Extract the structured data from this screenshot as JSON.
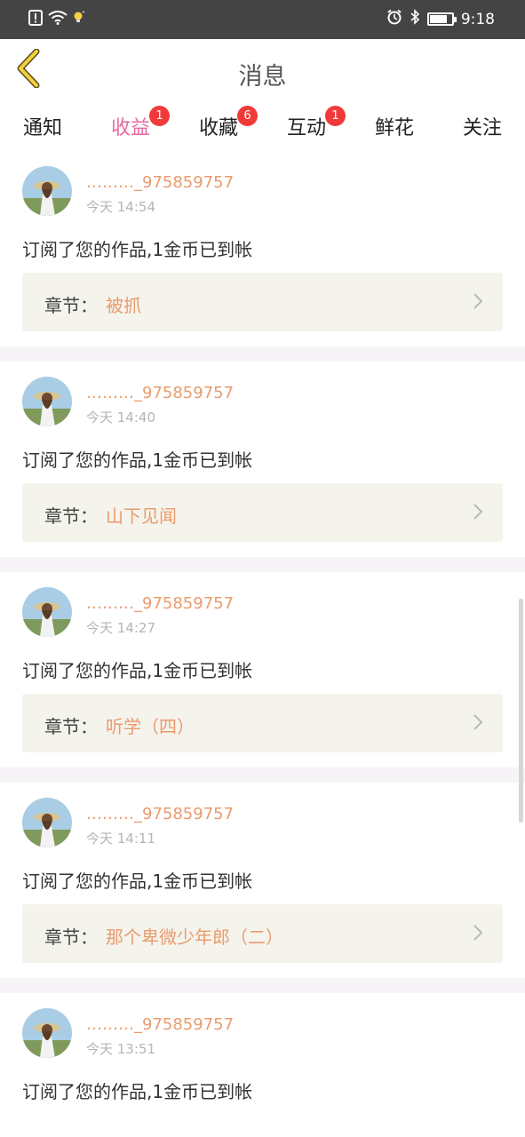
{
  "statusbar": {
    "time": "9:18",
    "battery_level": 0.75,
    "icons_left": [
      "alert-icon",
      "wifi-icon",
      "bulb-icon"
    ],
    "icons_right": [
      "alarm-icon",
      "bluetooth-icon",
      "battery-icon"
    ]
  },
  "header": {
    "title": "消息",
    "back_icon": "chevron-left-icon"
  },
  "colors": {
    "accent": "#e66aa0",
    "username": "#e99b6e",
    "badge": "#f03a3a",
    "statusbar": "#444444"
  },
  "tabs": [
    {
      "label": "通知",
      "badge": ""
    },
    {
      "label": "收益",
      "badge": "1",
      "active": true
    },
    {
      "label": "收藏",
      "badge": "6"
    },
    {
      "label": "互动",
      "badge": "1"
    },
    {
      "label": "鲜花",
      "badge": ""
    },
    {
      "label": "关注",
      "badge": ""
    }
  ],
  "messages": [
    {
      "username": "………_975859757",
      "time": "今天 14:54",
      "text": "订阅了您的作品,1金币已到帐",
      "chapter_label": "章节：",
      "chapter_title": "被抓"
    },
    {
      "username": "………_975859757",
      "time": "今天 14:40",
      "text": "订阅了您的作品,1金币已到帐",
      "chapter_label": "章节：",
      "chapter_title": "山下见闻"
    },
    {
      "username": "………_975859757",
      "time": "今天 14:27",
      "text": "订阅了您的作品,1金币已到帐",
      "chapter_label": "章节：",
      "chapter_title": "听学（四）"
    },
    {
      "username": "………_975859757",
      "time": "今天 14:11",
      "text": "订阅了您的作品,1金币已到帐",
      "chapter_label": "章节：",
      "chapter_title": "那个卑微少年郎（二）"
    },
    {
      "username": "………_975859757",
      "time": "今天 13:51",
      "text": "订阅了您的作品,1金币已到帐",
      "chapter_label": "",
      "chapter_title": ""
    }
  ]
}
